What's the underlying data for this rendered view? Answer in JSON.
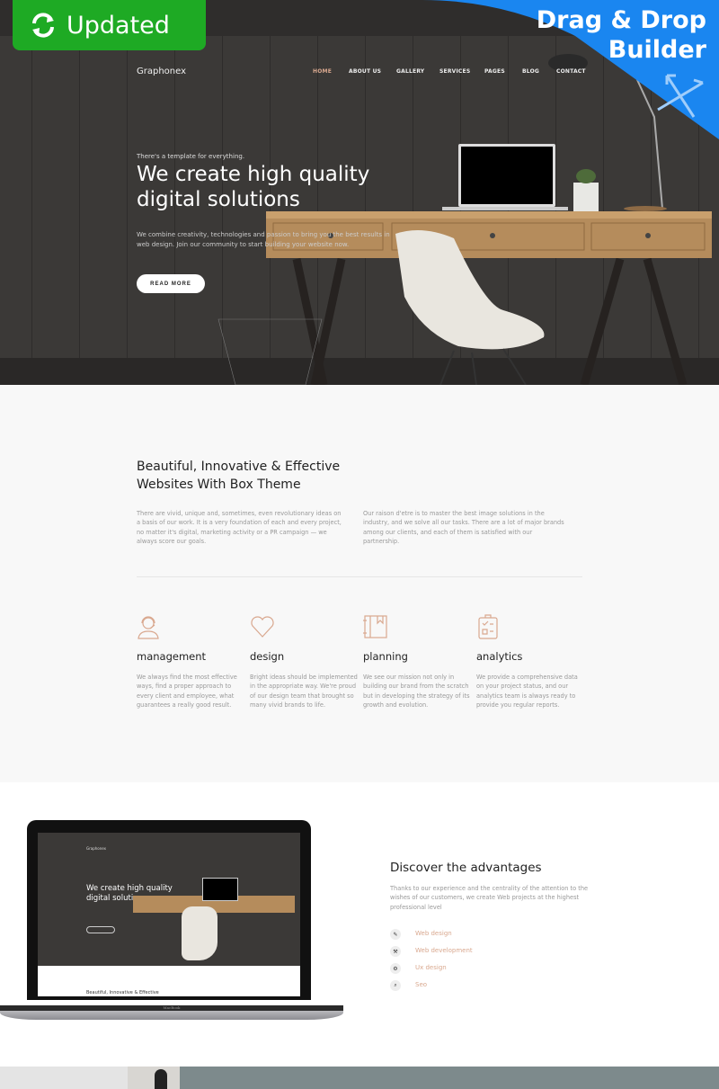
{
  "badges": {
    "updated": "Updated",
    "builder_line1": "Drag & Drop",
    "builder_line2": "Builder",
    "updated_color": "#1eaa24",
    "builder_color": "#1a86f0"
  },
  "header": {
    "brand": "Graphonex",
    "nav": [
      {
        "label": "HOME",
        "active": true
      },
      {
        "label": "ABOUT US"
      },
      {
        "label": "GALLERY"
      },
      {
        "label": "SERVICES"
      },
      {
        "label": "PAGES"
      },
      {
        "label": "BLOG"
      },
      {
        "label": "CONTACT"
      }
    ],
    "accent": "#d9a88f"
  },
  "hero": {
    "tagline": "There's a template for everything.",
    "title": "We create high quality digital solutions",
    "lead": "We combine creativity, technologies and passion to bring you the best results in web design. Join our community to start building your website now.",
    "button": "READ MORE"
  },
  "intro": {
    "title": "Beautiful, Innovative & Effective Websites With Box Theme",
    "col1": "There are vivid, unique and, sometimes, even revolutionary ideas on a basis of our work. It is a very foundation of each and every project, no matter it's digital, marketing activity or a PR campaign — we always score our goals.",
    "col2": "Our raison d'etre is to master the best image solutions in the industry, and we solve all our tasks. There are a lot of major brands among our clients, and each of them is satisfied with our partnership."
  },
  "features": [
    {
      "icon": "headset-user-icon",
      "title": "management",
      "text": "We always find the most effective ways, find a proper approach to every client and employee, what guarantees a really good result."
    },
    {
      "icon": "heart-icon",
      "title": "design",
      "text": "Bright ideas should be implemented in the appropriate way. We're proud of our design team that brought so many vivid brands to life."
    },
    {
      "icon": "notebook-icon",
      "title": "planning",
      "text": "We see our mission not only in building our brand from the scratch but in developing the strategy of its growth and evolution."
    },
    {
      "icon": "clipboard-checklist-icon",
      "title": "analytics",
      "text": "We provide a comprehensive data on your project status, and our analytics team is always ready to provide you regular reports."
    }
  ],
  "advantages": {
    "title": "Discover the advantages",
    "text": "Thanks to our experience and the centrality of the attention to the wishes of our customers, we create Web projects at the highest professional level",
    "items": [
      {
        "icon": "pencil-icon",
        "glyph": "✎",
        "label": "Web design"
      },
      {
        "icon": "wrench-icon",
        "glyph": "⚒",
        "label": "Web development"
      },
      {
        "icon": "gear-icon",
        "glyph": "⚙",
        "label": "Ux design"
      },
      {
        "icon": "search-icon",
        "glyph": "⌕",
        "label": "Seo"
      }
    ]
  },
  "mockup": {
    "brand": "Graphonex",
    "title": "We create high quality digital solutions",
    "section_peek": "Beautiful, Innovative & Effective",
    "device_label": "MacBook"
  }
}
